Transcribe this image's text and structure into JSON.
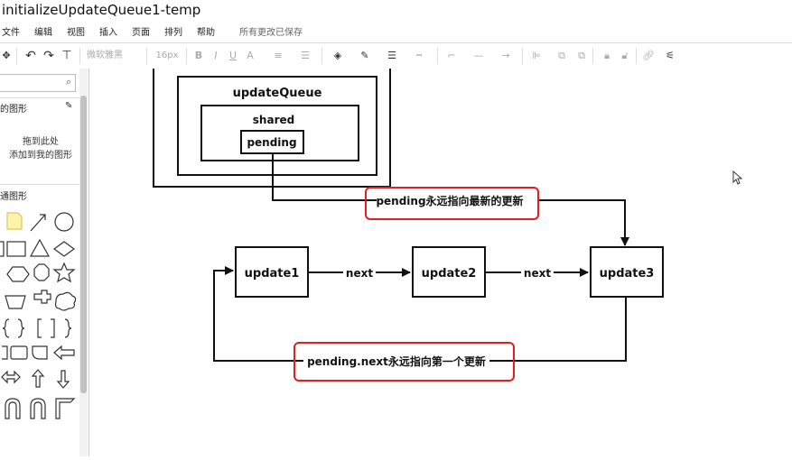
{
  "window": {
    "title": "initializeUpdateQueue1-temp"
  },
  "menu": {
    "items": [
      "文件",
      "编辑",
      "视图",
      "插入",
      "页面",
      "排列",
      "帮助"
    ],
    "saved_status": "所有更改已保存"
  },
  "toolbar": {
    "font_name": "微软雅黑",
    "font_size": "16px",
    "bold": "B",
    "italic": "I",
    "underline": "U",
    "font_color": "A"
  },
  "sidebar": {
    "search_placeholder": "",
    "scratchpad_title": "的图形",
    "scratchpad_hint_line1": "拖到此处",
    "scratchpad_hint_line2": "添加到我的图形",
    "general_title": "通图形"
  },
  "diagram": {
    "outer_label": "updateQueue",
    "shared_label": "shared",
    "pending_label": "pending",
    "update1": "update1",
    "update2": "update2",
    "update3": "update3",
    "edge_next_1": "next",
    "edge_next_2": "next",
    "annotation_top": "pending永远指向最新的更新",
    "annotation_bottom": "pending.next永远指向第一个更新",
    "highlight_color": "#e02020"
  }
}
